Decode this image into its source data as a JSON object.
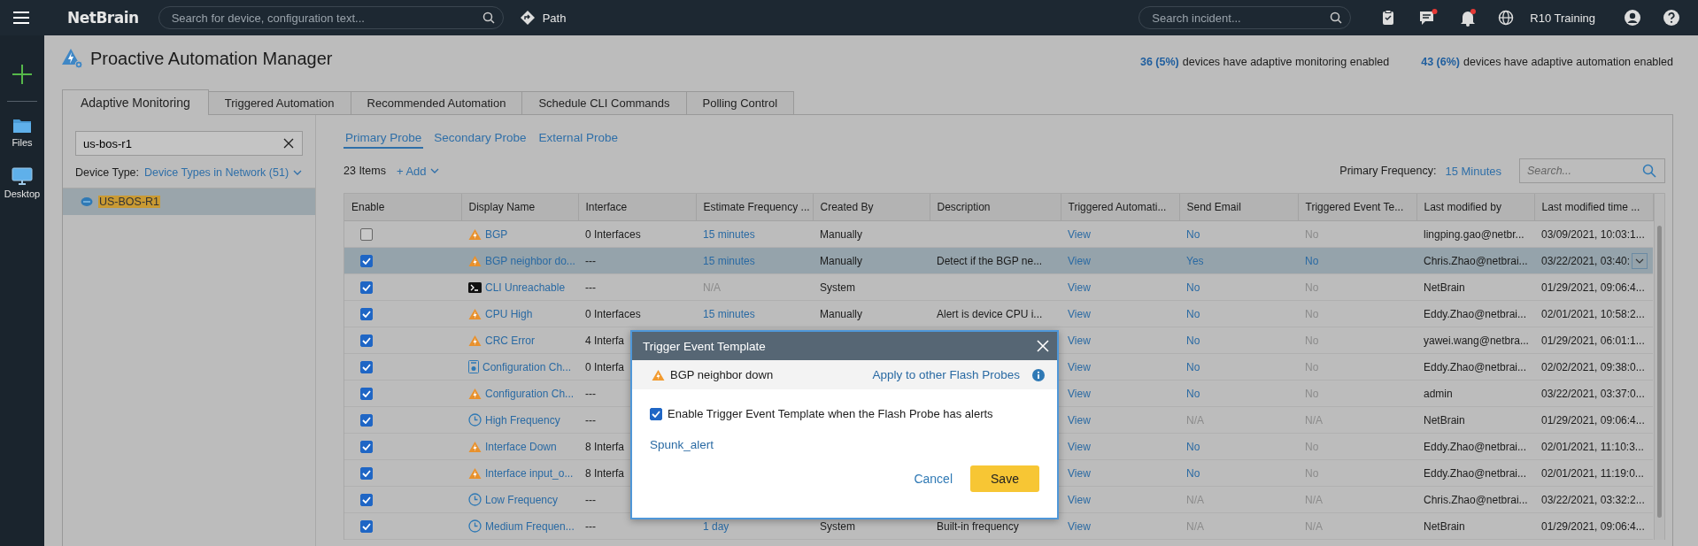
{
  "topbar": {
    "logo": "NetBrain",
    "search": {
      "placeholder": "Search for device, configuration text..."
    },
    "path": "Path",
    "incident_search": {
      "placeholder": "Search incident..."
    },
    "notifications": [
      {
        "kind": "clipboard",
        "badge": false
      },
      {
        "kind": "chat",
        "badge": true
      },
      {
        "kind": "bell",
        "badge": true
      }
    ],
    "domain": "R10 Training"
  },
  "rail": [
    {
      "kind": "add"
    },
    {
      "kind": "files",
      "label": "Files"
    },
    {
      "kind": "desktop",
      "label": "Desktop"
    }
  ],
  "page": {
    "title": "Proactive Automation Manager",
    "stats": [
      {
        "count": "36 (5%)",
        "text": "devices have adaptive monitoring enabled"
      },
      {
        "count": "43 (6%)",
        "text": "devices have adaptive automation enabled"
      }
    ]
  },
  "tabs": [
    {
      "label": "Adaptive Monitoring",
      "selected": true
    },
    {
      "label": "Triggered Automation",
      "selected": false
    },
    {
      "label": "Recommended Automation",
      "selected": false
    },
    {
      "label": "Schedule CLI Commands",
      "selected": false
    },
    {
      "label": "Polling Control",
      "selected": false
    }
  ],
  "device_search": {
    "value": "us-bos-r1"
  },
  "device_type": {
    "label": "Device Type:",
    "value": "Device Types in Network (51)"
  },
  "tree": [
    {
      "label": "US-BOS-R1",
      "selected": true
    }
  ],
  "probe_tabs": [
    {
      "label": "Primary Probe",
      "selected": true
    },
    {
      "label": "Secondary Probe",
      "selected": false
    },
    {
      "label": "External Probe",
      "selected": false
    }
  ],
  "items": "23 Items",
  "add": "+ Add",
  "primary_frequency": {
    "label": "Primary Frequency:",
    "value": "15 Minutes"
  },
  "table_search": {
    "placeholder": "Search..."
  },
  "table": {
    "columns": [
      "Enable",
      "Display Name",
      "Interface",
      "Estimate Frequency ...",
      "Created By",
      "Description",
      "Triggered Automati...",
      "Send Email",
      "Triggered Event Te...",
      "Last modified by",
      "Last modified time ..."
    ],
    "rows": [
      {
        "selected": false,
        "dropdown": false,
        "cells": [
          {
            "checked": false
          },
          {
            "kind": "warning",
            "text": "BGP"
          },
          "0 Interfaces",
          {
            "text": "15 minutes",
            "disabled": false
          },
          "Manually",
          "",
          {
            "text": "View",
            "disabled": false
          },
          {
            "text": "No",
            "disabled": false
          },
          {
            "text": "No",
            "disabled": true
          },
          "lingping.gao@netbr...",
          "03/09/2021, 10:03:1..."
        ]
      },
      {
        "selected": true,
        "dropdown": true,
        "cells": [
          {
            "checked": true
          },
          {
            "kind": "warning",
            "text": "BGP neighbor do..."
          },
          "---",
          {
            "text": "15 minutes",
            "disabled": false
          },
          "Manually",
          "Detect if the BGP ne...",
          {
            "text": "View",
            "disabled": false
          },
          {
            "text": "Yes",
            "disabled": false
          },
          {
            "text": "No",
            "disabled": false
          },
          "Chris.Zhao@netbrai...",
          "03/22/2021, 03:40:"
        ]
      },
      {
        "selected": false,
        "dropdown": false,
        "cells": [
          {
            "checked": true
          },
          {
            "kind": "terminal",
            "text": "CLI Unreachable"
          },
          "---",
          {
            "text": "N/A",
            "disabled": true
          },
          "System",
          "",
          {
            "text": "View",
            "disabled": false
          },
          {
            "text": "No",
            "disabled": false
          },
          {
            "text": "No",
            "disabled": true
          },
          "NetBrain",
          "01/29/2021, 09:06:4..."
        ]
      },
      {
        "selected": false,
        "dropdown": false,
        "cells": [
          {
            "checked": true
          },
          {
            "kind": "warning",
            "text": "CPU High"
          },
          "0 Interfaces",
          {
            "text": "15 minutes",
            "disabled": false
          },
          "Manually",
          "Alert is device CPU i...",
          {
            "text": "View",
            "disabled": false
          },
          {
            "text": "No",
            "disabled": false
          },
          {
            "text": "No",
            "disabled": true
          },
          "Eddy.Zhao@netbrai...",
          "02/01/2021, 10:58:2..."
        ]
      },
      {
        "selected": false,
        "dropdown": false,
        "cells": [
          {
            "checked": true
          },
          {
            "kind": "warning",
            "text": "CRC Error"
          },
          "4 Interfa",
          "",
          "",
          "",
          {
            "text": "View",
            "disabled": false
          },
          {
            "text": "No",
            "disabled": false
          },
          {
            "text": "No",
            "disabled": true
          },
          "yawei.wang@netbra...",
          "01/29/2021, 06:01:1..."
        ]
      },
      {
        "selected": false,
        "dropdown": false,
        "cells": [
          {
            "checked": true
          },
          {
            "kind": "config",
            "text": "Configuration Ch..."
          },
          "0 Interfa",
          "",
          "",
          "",
          {
            "text": "View",
            "disabled": false
          },
          {
            "text": "No",
            "disabled": false
          },
          {
            "text": "No",
            "disabled": true
          },
          "Eddy.Zhao@netbrai...",
          "02/02/2021, 09:38:0..."
        ]
      },
      {
        "selected": false,
        "dropdown": false,
        "cells": [
          {
            "checked": true
          },
          {
            "kind": "warning",
            "text": "Configuration Ch..."
          },
          "---",
          "",
          "",
          "",
          {
            "text": "View",
            "disabled": false
          },
          {
            "text": "No",
            "disabled": false
          },
          {
            "text": "No",
            "disabled": true
          },
          "admin",
          "03/22/2021, 03:37:0..."
        ]
      },
      {
        "selected": false,
        "dropdown": false,
        "cells": [
          {
            "checked": true
          },
          {
            "kind": "clock",
            "text": "High Frequency"
          },
          "---",
          "",
          "",
          "",
          {
            "text": "View",
            "disabled": false
          },
          {
            "text": "N/A",
            "disabled": true
          },
          {
            "text": "N/A",
            "disabled": true
          },
          "NetBrain",
          "01/29/2021, 09:06:4..."
        ]
      },
      {
        "selected": false,
        "dropdown": false,
        "cells": [
          {
            "checked": true
          },
          {
            "kind": "warning",
            "text": "Interface Down"
          },
          "8 Interfa",
          "",
          "",
          "",
          {
            "text": "View",
            "disabled": false
          },
          {
            "text": "No",
            "disabled": false
          },
          {
            "text": "No",
            "disabled": true
          },
          "Eddy.Zhao@netbrai...",
          "02/01/2021, 11:10:3..."
        ]
      },
      {
        "selected": false,
        "dropdown": false,
        "cells": [
          {
            "checked": true
          },
          {
            "kind": "warning",
            "text": "Interface input_o..."
          },
          "8 Interfa",
          "",
          "",
          "",
          {
            "text": "View",
            "disabled": false
          },
          {
            "text": "No",
            "disabled": false
          },
          {
            "text": "No",
            "disabled": true
          },
          "Eddy.Zhao@netbrai...",
          "02/01/2021, 11:19:0..."
        ]
      },
      {
        "selected": false,
        "dropdown": false,
        "cells": [
          {
            "checked": true
          },
          {
            "kind": "clock",
            "text": "Low Frequency"
          },
          "---",
          "",
          "",
          "",
          {
            "text": "View",
            "disabled": false
          },
          {
            "text": "N/A",
            "disabled": true
          },
          {
            "text": "N/A",
            "disabled": true
          },
          "Chris.Zhao@netbrai...",
          "03/22/2021, 03:32:2..."
        ]
      },
      {
        "selected": false,
        "dropdown": false,
        "cells": [
          {
            "checked": true
          },
          {
            "kind": "clock",
            "text": "Medium Frequen..."
          },
          "---",
          {
            "text": "1 day",
            "disabled": false
          },
          "System",
          "Built-in frequency",
          {
            "text": "View",
            "disabled": false
          },
          {
            "text": "N/A",
            "disabled": true
          },
          {
            "text": "N/A",
            "disabled": true
          },
          "NetBrain",
          "01/29/2021, 09:06:4..."
        ]
      }
    ]
  },
  "dialog": {
    "title": "Trigger Event Template",
    "probe": {
      "kind": "warning",
      "name": "BGP neighbor down"
    },
    "apply_link": "Apply to other Flash Probes",
    "option": {
      "label": "Enable Trigger Event Template when the Flash Probe has alerts",
      "checked": true
    },
    "template": "Spunk_alert",
    "buttons": {
      "cancel": "Cancel",
      "save": "Save"
    }
  }
}
